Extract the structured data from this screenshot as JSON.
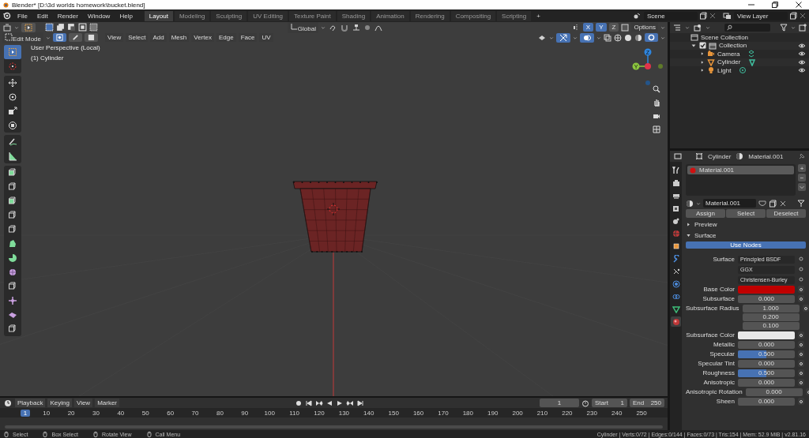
{
  "window": {
    "title": "Blender* [D:\\3d worlds homework\\bucket.blend]"
  },
  "menu": [
    "File",
    "Edit",
    "Render",
    "Window",
    "Help"
  ],
  "workspaces": [
    {
      "label": "Layout",
      "selected": true
    },
    {
      "label": "Modeling",
      "selected": false
    },
    {
      "label": "Sculpting",
      "selected": false
    },
    {
      "label": "UV Editing",
      "selected": false
    },
    {
      "label": "Texture Paint",
      "selected": false
    },
    {
      "label": "Shading",
      "selected": false
    },
    {
      "label": "Animation",
      "selected": false
    },
    {
      "label": "Rendering",
      "selected": false
    },
    {
      "label": "Compositing",
      "selected": false
    },
    {
      "label": "Scripting",
      "selected": false
    }
  ],
  "add_workspace": "+",
  "scene": "Scene",
  "view_layer": "View Layer",
  "viewport": {
    "orientation": "Global",
    "options": "Options",
    "mirror_axes": [
      {
        "label": "X",
        "on": true
      },
      {
        "label": "Y",
        "on": true
      },
      {
        "label": "Z",
        "on": false
      }
    ],
    "mode": "Edit Mode",
    "select_modes": [
      {
        "selected": true
      },
      {
        "selected": false
      },
      {
        "selected": false
      }
    ],
    "menus": [
      "View",
      "Select",
      "Add",
      "Mesh",
      "Vertex",
      "Edge",
      "Face",
      "UV"
    ],
    "overlay_lines": [
      "User Perspective (Local)",
      "(1) Cylinder"
    ],
    "gizmo": [
      "Z",
      "Y"
    ]
  },
  "outliner": {
    "root": "Scene Collection",
    "collections": [
      {
        "label": "Collection",
        "checked": true,
        "expanded": true,
        "children": [
          {
            "label": "Camera",
            "kind": "camera"
          },
          {
            "label": "Cylinder",
            "kind": "mesh"
          },
          {
            "label": "Light",
            "kind": "light"
          }
        ]
      }
    ]
  },
  "properties": {
    "object": "Cylinder",
    "material": "Material.001",
    "tabs": [
      {
        "selected": false
      },
      {
        "selected": false
      },
      {
        "selected": false
      },
      {
        "selected": false
      },
      {
        "selected": false
      },
      {
        "selected": false
      },
      {
        "selected": false
      },
      {
        "selected": false
      },
      {
        "selected": false
      },
      {
        "selected": false
      },
      {
        "selected": false
      },
      {
        "selected": false
      },
      {
        "selected": true
      }
    ],
    "slots": [
      {
        "label": "Material.001",
        "selected": true
      }
    ],
    "slot_buttons": [
      "+",
      "−"
    ],
    "material_field": "Material.001",
    "actions": [
      "Assign",
      "Select",
      "Deselect"
    ],
    "panels": [
      {
        "label": "Preview",
        "expanded": false
      },
      {
        "label": "Surface",
        "expanded": true
      }
    ],
    "use_nodes": "Use Nodes",
    "fields": [
      {
        "kind": "dropdown",
        "label": "Surface",
        "value": "Principled BSDF"
      },
      {
        "kind": "dropdown",
        "value": "GGX"
      },
      {
        "kind": "dropdown",
        "value": "Christensen-Burley"
      },
      {
        "kind": "color",
        "label": "Base Color",
        "color": "#c00000"
      },
      {
        "kind": "number",
        "label": "Subsurface",
        "value": "0.000"
      },
      {
        "kind": "vector",
        "label": "Subsurface Radius",
        "values": [
          "1.000",
          "0.200",
          "0.100"
        ]
      },
      {
        "kind": "color",
        "label": "Subsurface Color",
        "color": "#e8e8e8"
      },
      {
        "kind": "number",
        "label": "Metallic",
        "value": "0.000"
      },
      {
        "kind": "slider",
        "label": "Specular",
        "value": "0.500",
        "level": 0.5
      },
      {
        "kind": "number",
        "label": "Specular Tint",
        "value": "0.000"
      },
      {
        "kind": "slider",
        "label": "Roughness",
        "value": "0.500",
        "level": 0.5
      },
      {
        "kind": "number",
        "label": "Anisotropic",
        "value": "0.000"
      },
      {
        "kind": "number",
        "label": "Anisotropic Rotation",
        "value": "0.000"
      },
      {
        "kind": "number",
        "label": "Sheen",
        "value": "0.000"
      }
    ]
  },
  "timeline": {
    "menus": [
      "Playback",
      "Keying",
      "View",
      "Marker"
    ],
    "current_frame": "1",
    "start_label": "Start",
    "start": "1",
    "end_label": "End",
    "end": "250",
    "playhead": "1",
    "ticks": [
      "10",
      "20",
      "30",
      "40",
      "50",
      "60",
      "70",
      "80",
      "90",
      "100",
      "110",
      "120",
      "130",
      "140",
      "150",
      "160",
      "170",
      "180",
      "190",
      "200",
      "210",
      "220",
      "230",
      "240",
      "250"
    ]
  },
  "status_bar": {
    "hints": [
      "Select",
      "Box Select",
      "Rotate View",
      "Call Menu"
    ],
    "stats": "Cylinder | Verts:0/72 | Edges:0/144 | Faces:0/73 | Tris:154 | Mem: 52.9 MiB | v2.81.16"
  }
}
